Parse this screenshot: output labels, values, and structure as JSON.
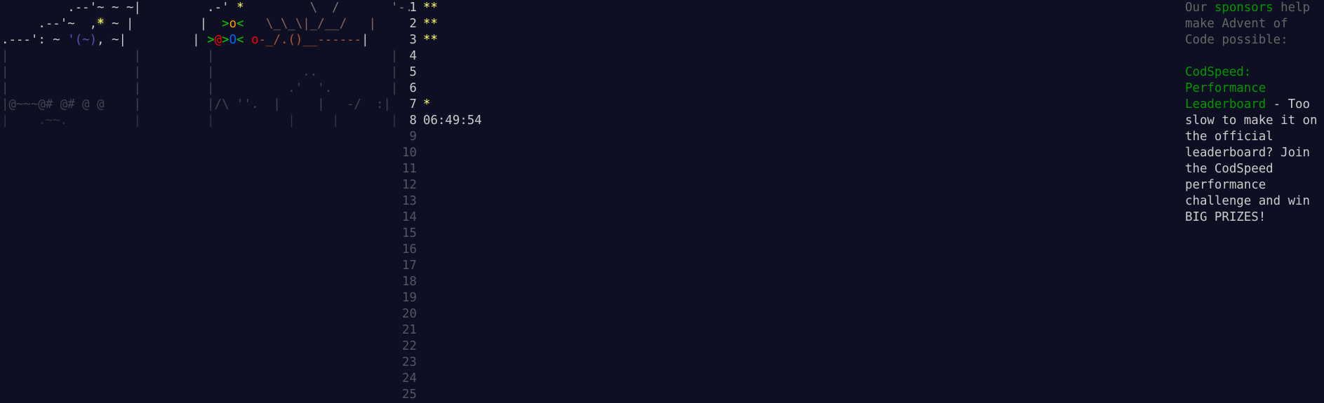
{
  "calendar": {
    "rows": [
      [
        {
          "t": "         .--'~ ~ ~|         ",
          "c": "lt"
        },
        {
          "t": ".-' ",
          "c": "lt"
        },
        {
          "t": "*",
          "c": "star-y2"
        },
        {
          "t": "         \\  /       '-.",
          "c": "mid"
        }
      ],
      [
        {
          "t": "     .--'~  ,",
          "c": "lt"
        },
        {
          "t": "*",
          "c": "star-y"
        },
        {
          "t": " ~ |         |  ",
          "c": "lt"
        },
        {
          "t": ">",
          "c": "green"
        },
        {
          "t": "o",
          "c": "orange"
        },
        {
          "t": "<",
          "c": "green"
        },
        {
          "t": "   \\_\\_\\|_/__/   |",
          "c": "brown"
        }
      ],
      [
        {
          "t": ".---': ~ ",
          "c": "lt"
        },
        {
          "t": "'(~)",
          "c": "ltblue"
        },
        {
          "t": ", ~|         | ",
          "c": "lt"
        },
        {
          "t": ">",
          "c": "green"
        },
        {
          "t": "@",
          "c": "red"
        },
        {
          "t": ">",
          "c": "green"
        },
        {
          "t": "O",
          "c": "blue"
        },
        {
          "t": "< ",
          "c": "green"
        },
        {
          "t": "o",
          "c": "red"
        },
        {
          "t": "-_/.()__------",
          "c": "redbrown"
        },
        {
          "t": "|",
          "c": "lt"
        }
      ],
      [
        {
          "t": "|                 |         |                        |",
          "c": "frame-dim"
        }
      ],
      [
        {
          "t": "|                 |         |            ..          |",
          "c": "frame-dim"
        }
      ],
      [
        {
          "t": "|                 |         |          .'  '.        |",
          "c": "frame-dim"
        }
      ],
      [
        {
          "t": "|@~~~@# @# @ @    |         |/\\ ''.  |     |   -/  :|",
          "c": "frame-dim"
        }
      ],
      [
        {
          "t": "|    .~~.         |         |          |     |       |",
          "c": "dim"
        }
      ]
    ]
  },
  "days": [
    {
      "n": "1",
      "v": "**",
      "kind": "stars"
    },
    {
      "n": "2",
      "v": "**",
      "kind": "stars"
    },
    {
      "n": "3",
      "v": "**",
      "kind": "stars"
    },
    {
      "n": "4",
      "v": "",
      "kind": "open"
    },
    {
      "n": "5",
      "v": "",
      "kind": "open"
    },
    {
      "n": "6",
      "v": "",
      "kind": "open"
    },
    {
      "n": "7",
      "v": "*",
      "kind": "stars"
    },
    {
      "n": "8",
      "v": "06:49:54",
      "kind": "time"
    },
    {
      "n": "9",
      "v": "",
      "kind": "locked"
    },
    {
      "n": "10",
      "v": "",
      "kind": "locked"
    },
    {
      "n": "11",
      "v": "",
      "kind": "locked"
    },
    {
      "n": "12",
      "v": "",
      "kind": "locked"
    },
    {
      "n": "13",
      "v": "",
      "kind": "locked"
    },
    {
      "n": "14",
      "v": "",
      "kind": "locked"
    },
    {
      "n": "15",
      "v": "",
      "kind": "locked"
    },
    {
      "n": "16",
      "v": "",
      "kind": "locked"
    },
    {
      "n": "17",
      "v": "",
      "kind": "locked"
    },
    {
      "n": "18",
      "v": "",
      "kind": "locked"
    },
    {
      "n": "19",
      "v": "",
      "kind": "locked"
    },
    {
      "n": "20",
      "v": "",
      "kind": "locked"
    },
    {
      "n": "21",
      "v": "",
      "kind": "locked"
    },
    {
      "n": "22",
      "v": "",
      "kind": "locked"
    },
    {
      "n": "23",
      "v": "",
      "kind": "locked"
    },
    {
      "n": "24",
      "v": "",
      "kind": "locked"
    },
    {
      "n": "25",
      "v": "",
      "kind": "locked"
    }
  ],
  "sidebar": {
    "intro_before": "Our ",
    "intro_link": "sponsors",
    "intro_after": " help make Advent of Code possible:",
    "sponsor_name": "CodSpeed: Performance Leaderboard",
    "sponsor_desc": " - Too slow to make it on the official leaderboard? Join the CodSpeed performance challenge and win BIG PRIZES!"
  },
  "colors": {
    "background": "#0f0f23",
    "text": "#cccccc",
    "star": "#ffff66",
    "link": "#009900",
    "muted": "#666666"
  }
}
